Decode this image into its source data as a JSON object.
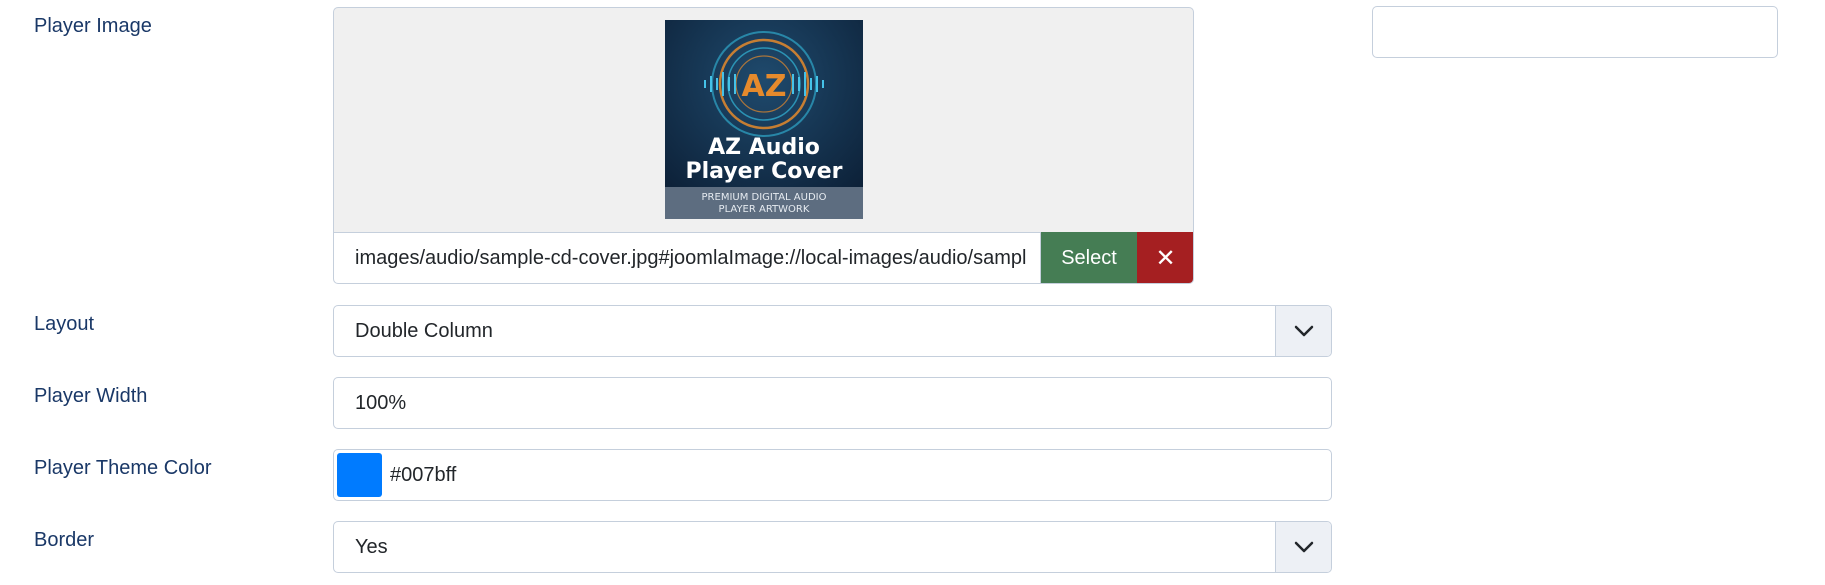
{
  "player_image": {
    "label": "Player Image",
    "path_value": "images/audio/sample-cd-cover.jpg#joomlaImage://local-images/audio/sample-cd-cover.jpg",
    "select_label": "Select",
    "clear_label": "✕",
    "preview": {
      "title_line1": "AZ Audio",
      "title_line2": "Player Cover",
      "subtitle_line1": "PREMIUM DIGITAL AUDIO",
      "subtitle_line2": "PLAYER ARTWORK",
      "logo_text": "AZ"
    }
  },
  "layout": {
    "label": "Layout",
    "value": "Double Column"
  },
  "player_width": {
    "label": "Player Width",
    "value": "100%"
  },
  "theme_color": {
    "label": "Player Theme Color",
    "value": "#007bff",
    "swatch_color": "#007bff"
  },
  "border": {
    "label": "Border",
    "value": "Yes"
  },
  "colors": {
    "label_text": "#1a3867",
    "select_button": "#457d54",
    "clear_button": "#a51f21"
  }
}
